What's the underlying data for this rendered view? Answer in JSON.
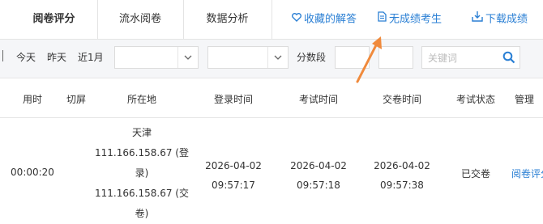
{
  "tabs": [
    {
      "label": "阅卷评分",
      "active": true
    },
    {
      "label": "流水阅卷",
      "active": false
    },
    {
      "label": "数据分析",
      "active": false
    }
  ],
  "actions": [
    {
      "label": "收藏的解答",
      "icon": "heart-icon"
    },
    {
      "label": "无成绩考生",
      "icon": "document-icon"
    },
    {
      "label": "下载成绩",
      "icon": "download-icon"
    }
  ],
  "filters": {
    "quick_ranges": [
      "今天",
      "昨天",
      "近1月"
    ],
    "score_range_label": "分数段",
    "keyword_placeholder": "关键词"
  },
  "table": {
    "headers": [
      "用时",
      "切屏",
      "所在地",
      "登录时间",
      "考试时间",
      "交卷时间",
      "考试状态",
      "管理"
    ],
    "rows": [
      {
        "duration": "00:00:20",
        "switch_count": "",
        "location_lines": [
          "天津",
          "111.166.158.67 (登",
          "录)",
          "111.166.158.67 (交",
          "卷)"
        ],
        "login_date": "2026-04-02",
        "login_time": "09:57:17",
        "exam_date": "2026-04-02",
        "exam_time": "09:57:18",
        "submit_date": "2026-04-02",
        "submit_time": "09:57:38",
        "status": "已交卷",
        "manage_link": "阅卷评分"
      }
    ]
  },
  "colors": {
    "link": "#2a7fd4",
    "annotation_arrow": "#f08a3c"
  }
}
